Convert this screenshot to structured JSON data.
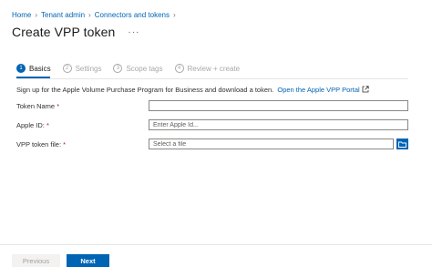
{
  "breadcrumb": [
    "Home",
    "Tenant admin",
    "Connectors and tokens"
  ],
  "page_title": "Create VPP token",
  "more_label": "···",
  "steps": [
    {
      "number": "1",
      "label": "Basics"
    },
    {
      "number": "2",
      "label": "Settings"
    },
    {
      "number": "3",
      "label": "Scope tags"
    },
    {
      "number": "4",
      "label": "Review + create"
    }
  ],
  "description": {
    "text": "Sign up for the Apple Volume Purchase Program for Business and download a token.",
    "link": "Open the Apple VPP Portal"
  },
  "form": {
    "token_name": {
      "label": "Token Name",
      "required_mark": "*",
      "value": "",
      "placeholder": ""
    },
    "apple_id": {
      "label": "Apple ID:",
      "required_mark": "*",
      "value": "",
      "placeholder": "Enter Apple Id..."
    },
    "vpp_file": {
      "label": "VPP token file:",
      "required_mark": "*",
      "value": "",
      "placeholder": "Select a file"
    }
  },
  "footer": {
    "previous_label": "Previous",
    "next_label": "Next"
  },
  "colors": {
    "accent": "#0064b4",
    "required": "#a4262c",
    "disabled_text": "#a19f9d"
  },
  "icons": {
    "external_link": "external-link-icon",
    "folder": "folder-icon"
  }
}
